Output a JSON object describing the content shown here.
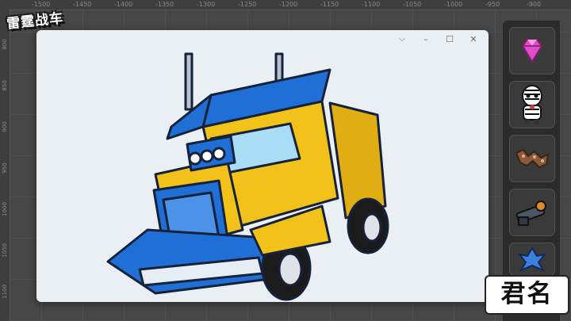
{
  "app": {
    "logo_text": "雷霆战车"
  },
  "ruler": {
    "top_ticks": [
      "-1500",
      "-1450",
      "-1400",
      "-1350",
      "-1300",
      "-1250",
      "-1200",
      "-1150",
      "-1100",
      "-1050",
      "-1000",
      "-950",
      "-900",
      "-850"
    ],
    "left_ticks": [
      "800",
      "850",
      "900",
      "950",
      "1000",
      "1050",
      "1100",
      "1150",
      "1200"
    ]
  },
  "window": {
    "controls": {
      "dropdown": "⌵",
      "minimize": "–",
      "maximize": "☐",
      "close": "✕"
    },
    "image": "yellow-blue-cartoon-semi-truck"
  },
  "inventory": {
    "slots": [
      {
        "icon": "pink-gem-icon"
      },
      {
        "icon": "zebra-character-icon"
      },
      {
        "icon": "chain-track-icon"
      },
      {
        "icon": "cannon-icon"
      },
      {
        "icon": "blue-mech-part-icon"
      }
    ]
  },
  "signature": {
    "text": "君名"
  },
  "colors": {
    "truck_yellow": "#f2c21b",
    "truck_blue": "#1f6fd6",
    "gem_pink": "#e24cc6"
  }
}
